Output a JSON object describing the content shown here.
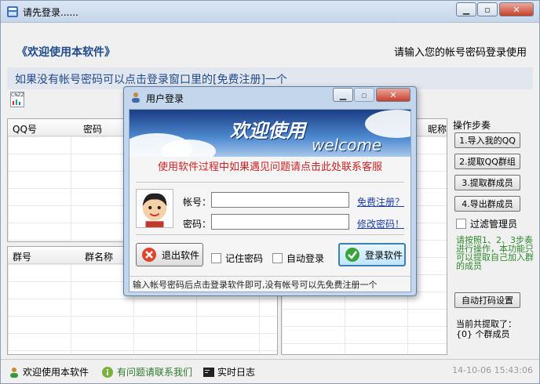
{
  "window": {
    "title": "请先登录......",
    "welcome_left": "《欢迎使用本软件》",
    "welcome_right": "请输入您的帐号密码登录使用",
    "info_text": "如果没有帐号密码可以点击登录窗口里的[免费注册]一个",
    "small_icon_text": "CNZZ"
  },
  "grids": {
    "top_left_headers": [
      "QQ号",
      "密码"
    ],
    "right_header": "昵称",
    "bottom_left_headers": [
      "群号",
      "群名称"
    ]
  },
  "steps": {
    "title": "操作步奏",
    "buttons": [
      "1.导入我的QQ",
      "2.提取QQ群组",
      "3.提取群成员",
      "4.导出群成员"
    ],
    "filter_label": "过滤管理员",
    "guide_text": "请按照1、2、3步奏进行操作，本功能只可以提取自己加入群的成员",
    "auto_captcha_label": "自动打码设置",
    "summary_line1": "当前共提取了：",
    "summary_line2": "{0} 个群成员"
  },
  "statusbar": {
    "welcome": "欢迎使用本软件",
    "contact": "有问题请联系我们",
    "log": "实时日志",
    "timestamp": "14-10-06 15:43:06"
  },
  "dialog": {
    "title": "用户登录",
    "banner_title": "欢迎使用",
    "banner_sub": "welcome",
    "notice": "使用软件过程中如果遇见问题请点击此处联系客服",
    "account_label": "帐号：",
    "password_label": "密码：",
    "account_value": "",
    "password_value": "",
    "register_link": "免费注册？",
    "change_pwd_link": "修改密码！",
    "exit_button": "退出软件",
    "remember_label": "记住密码",
    "auto_login_label": "自动登录",
    "login_button": "登录软件",
    "footer": "输入帐号密码后点击登录软件即可,没有帐号可以先免费注册一个"
  },
  "colors": {
    "accent_blue": "#1f4a8c",
    "notice_red": "#d02020",
    "guide_green": "#2d8a2d",
    "link_blue": "#1c3ea6"
  }
}
